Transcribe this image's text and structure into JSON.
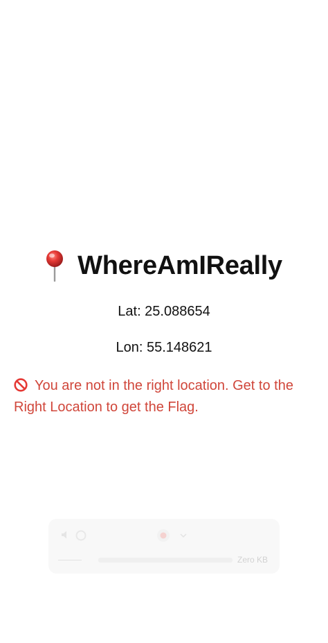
{
  "app": {
    "title": "WhereAmIReally",
    "pin_icon": "round-pushpin-icon"
  },
  "location": {
    "lat_text": "Lat: 25.088654",
    "lon_text": "Lon: 55.148621"
  },
  "status": {
    "icon": "no-entry-icon",
    "message": "You are not in the right location. Get to the Right Location to get the Flag.",
    "color": "#d0463a"
  },
  "overlay": {
    "size_label": "Zero KB",
    "icons": [
      "speaker-icon",
      "circle-icon",
      "record-icon",
      "chevron-down-icon"
    ]
  }
}
